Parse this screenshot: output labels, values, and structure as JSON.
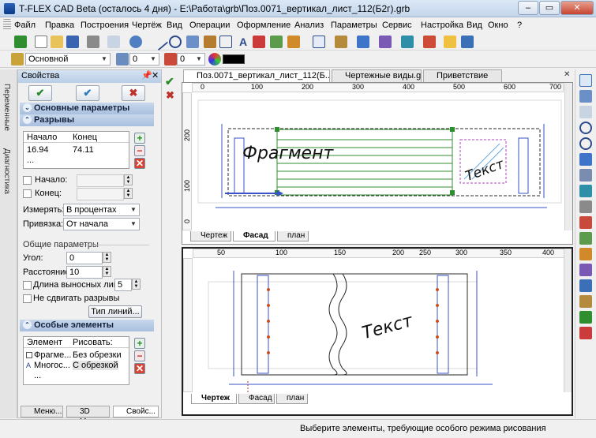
{
  "window": {
    "title": "T-FLEX CAD Beta (осталось 4 дня) - E:\\Работа\\grb\\Поз.0071_вертикал_лист_112(Б2г).grb",
    "btn_min": "–",
    "btn_max": "▭",
    "btn_close": "✕"
  },
  "menu": [
    "Файл",
    "Правка",
    "Построения",
    "Чертёж",
    "Вид",
    "Операции",
    "Оформление",
    "Анализ",
    "Параметры",
    "Сервис",
    "Настройка",
    "Вид",
    "Окно",
    "?"
  ],
  "toolbar2": {
    "style_value": "Основной",
    "layer_value": "0",
    "priority_value": "0",
    "color_value": "#000000"
  },
  "side_tabs": [
    "Переменные",
    "Диагностика"
  ],
  "properties": {
    "title": "Свойства",
    "pin_icon": "📌",
    "close_icon": "✕",
    "ok": "✔",
    "apply": "✔",
    "cancel": "✖",
    "section_main": "Основные параметры",
    "section_breaks": "Разрывы",
    "breaks_table": {
      "headers": [
        "Начало",
        "Конец"
      ],
      "rows": [
        [
          "16.94",
          "74.11"
        ],
        [
          "...",
          ""
        ]
      ]
    },
    "start_label": "Начало:",
    "end_label": "Конец:",
    "measure_label": "Измерять:",
    "measure_value": "В процентах",
    "bind_label": "Привязка:",
    "bind_value": "От начала",
    "common_label": "Общие параметры",
    "angle_label": "Угол:",
    "angle_value": "0",
    "distance_label": "Расстояние:",
    "distance_value": "10",
    "ext_len_label": "Длина выносных линий:",
    "ext_len_value": "5",
    "no_shift_label": "Не сдвигать разрывы",
    "line_type_btn": "Тип линий...",
    "section_special": "Особые элементы",
    "special_table": {
      "headers": [
        "Элемент",
        "Рисовать:"
      ],
      "rows": [
        [
          "Фрагме...",
          "Без обрезки"
        ],
        [
          "Многос...",
          "С обрезкой"
        ],
        [
          "...",
          ""
        ]
      ]
    },
    "plus": "+",
    "minus": "−",
    "del": "✕"
  },
  "bottom_tabs": [
    "Меню...",
    "3D Мо...",
    "Свойс..."
  ],
  "doc_tabs": [
    "Поз.0071_вертикал_лист_112(Б...",
    "Чертежные виды.grb",
    "Приветствие"
  ],
  "top_view": {
    "ruler_x": [
      "0",
      "100",
      "200",
      "300",
      "400",
      "500",
      "600",
      "700"
    ],
    "ruler_y": [
      "200",
      "100",
      "0"
    ],
    "fragment_text": "Фрагмент",
    "text_label": "Текст",
    "tabs": [
      "Чертеж",
      "Фасад",
      "план"
    ],
    "active_tab": 1
  },
  "bottom_view": {
    "ruler_x": [
      "50",
      "100",
      "150",
      "200",
      "250",
      "300",
      "350",
      "400"
    ],
    "text_label": "Текст",
    "tabs": [
      "Чертеж",
      "Фасад",
      "план"
    ],
    "active_tab": 0
  },
  "status": {
    "message": "Выберите элементы, требующие особого режима рисования"
  }
}
